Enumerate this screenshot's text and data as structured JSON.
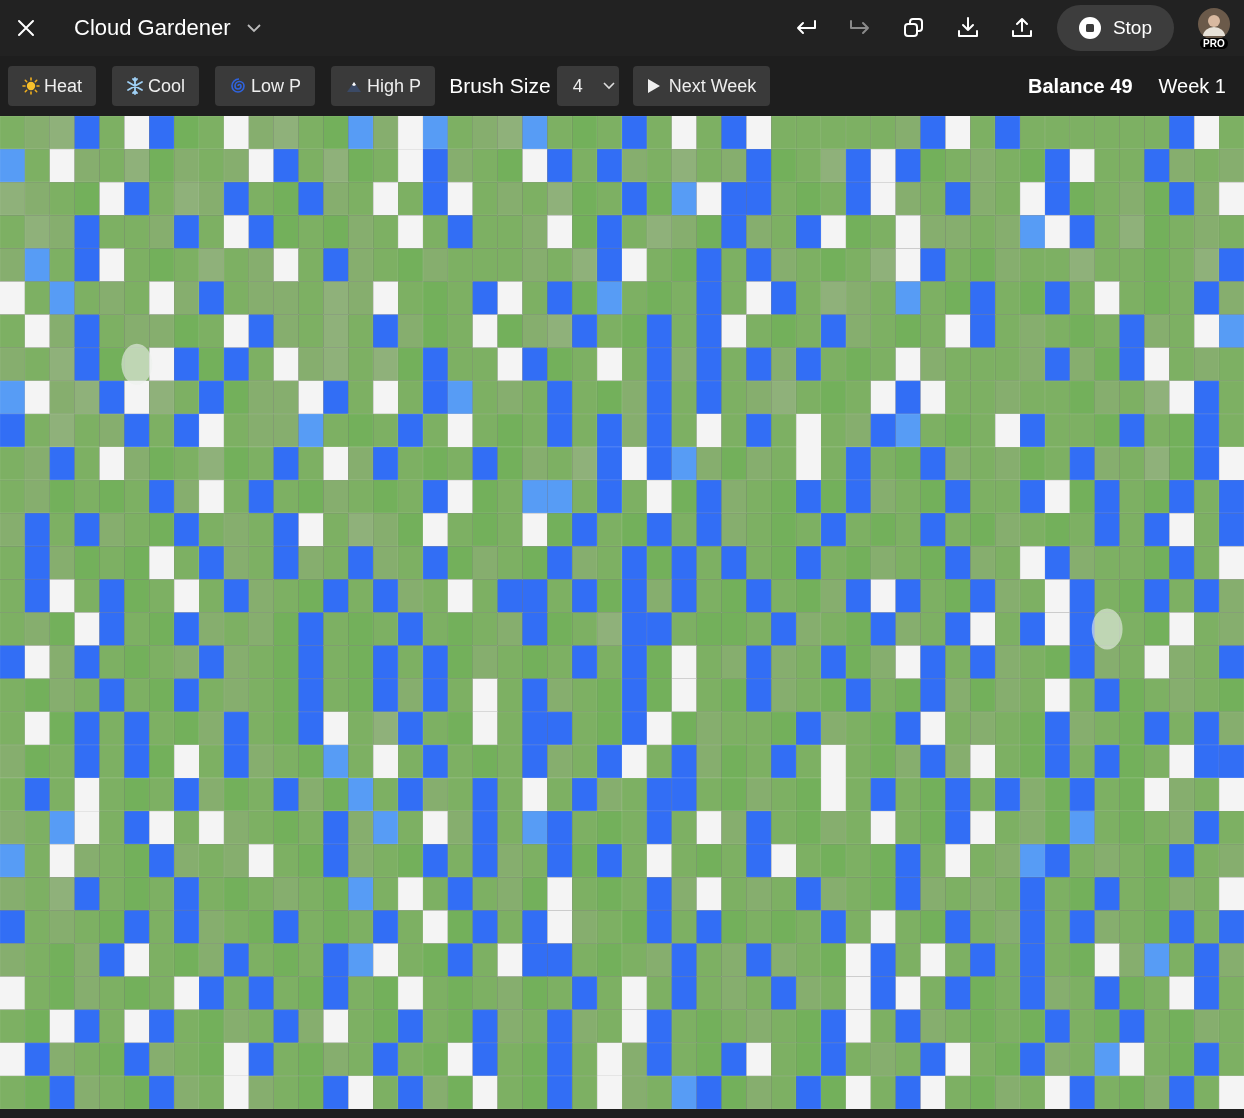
{
  "window": {
    "title": "Cloud Gardener"
  },
  "toolbar_actions": [
    {
      "kind": "undo",
      "disabled": false
    },
    {
      "kind": "redo",
      "disabled": true
    },
    {
      "kind": "duplicate",
      "disabled": false
    },
    {
      "kind": "download",
      "disabled": false
    },
    {
      "kind": "upload",
      "disabled": false
    }
  ],
  "run_button": {
    "label": "Stop"
  },
  "account": {
    "badge": "PRO"
  },
  "tools": [
    {
      "kind": "heat",
      "label": "Heat"
    },
    {
      "kind": "cool",
      "label": "Cool"
    },
    {
      "kind": "low",
      "label": "Low P"
    },
    {
      "kind": "high",
      "label": "High P"
    }
  ],
  "brush_size": {
    "label": "Brush Size",
    "value": "4"
  },
  "next_button": {
    "label": "Next Week"
  },
  "balance": "Balance 49",
  "week": "Week 1"
}
